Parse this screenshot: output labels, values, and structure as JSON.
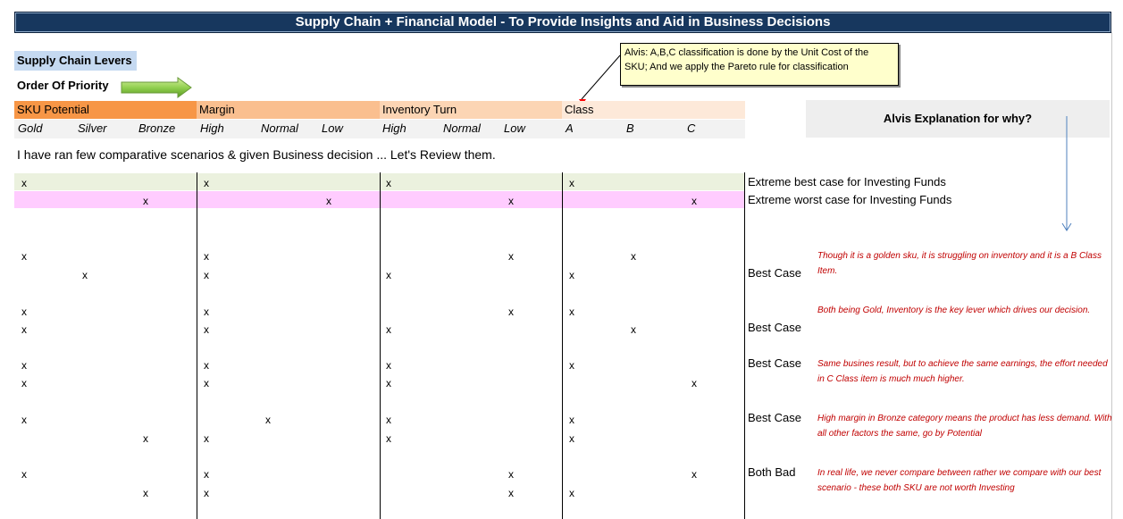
{
  "title": "Supply Chain + Financial Model - To Provide Insights and Aid in Business Decisions",
  "levers_label": "Supply Chain Levers",
  "priority_label": "Order Of Priority",
  "callout_text": "Alvis: A,B,C classification is done by the Unit Cost of the SKU; And we apply the Pareto rule for classification",
  "why_label": "Alvis Explanation for why?",
  "levers": [
    {
      "name": "SKU Potential",
      "color": "#f79646",
      "options": [
        "Gold",
        "Silver",
        "Bronze"
      ]
    },
    {
      "name": "Margin",
      "color": "#fabf8f",
      "options": [
        "High",
        "Normal",
        "Low"
      ]
    },
    {
      "name": "Inventory Turn",
      "color": "#fcd5b4",
      "options": [
        "High",
        "Normal",
        "Low"
      ]
    },
    {
      "name": "Class",
      "color": "#fde9d9",
      "options": [
        "A",
        "B",
        "C"
      ]
    }
  ],
  "scenario_intro": "I have ran few comparative scenarios & given Business decision ... Let's Review them.",
  "mark": "x",
  "extremes": [
    {
      "label": "Extreme best case for Investing Funds",
      "band_color": "#ebf1de"
    },
    {
      "label": "Extreme worst case for Investing Funds",
      "band_color": "#ffccff"
    }
  ],
  "scenarios": [
    {
      "label": "Best Case",
      "explanation": "Though it is a golden sku, it is struggling on inventory and it is a B Class Item."
    },
    {
      "label": "Best Case",
      "explanation": "Both being Gold, Inventory is the key lever which drives our decision."
    },
    {
      "label": "Best Case",
      "explanation": "Same busines result, but to achieve the same earnings, the effort needed in C Class item is much much higher."
    },
    {
      "label": "Best Case",
      "explanation": "High margin in Bronze category means the product has less demand. With all other factors the same, go by Potential"
    },
    {
      "label": "Both Bad",
      "explanation": "In real life, we never compare between rather we compare with our best scenario - these both SKU are not worth Investing"
    }
  ]
}
